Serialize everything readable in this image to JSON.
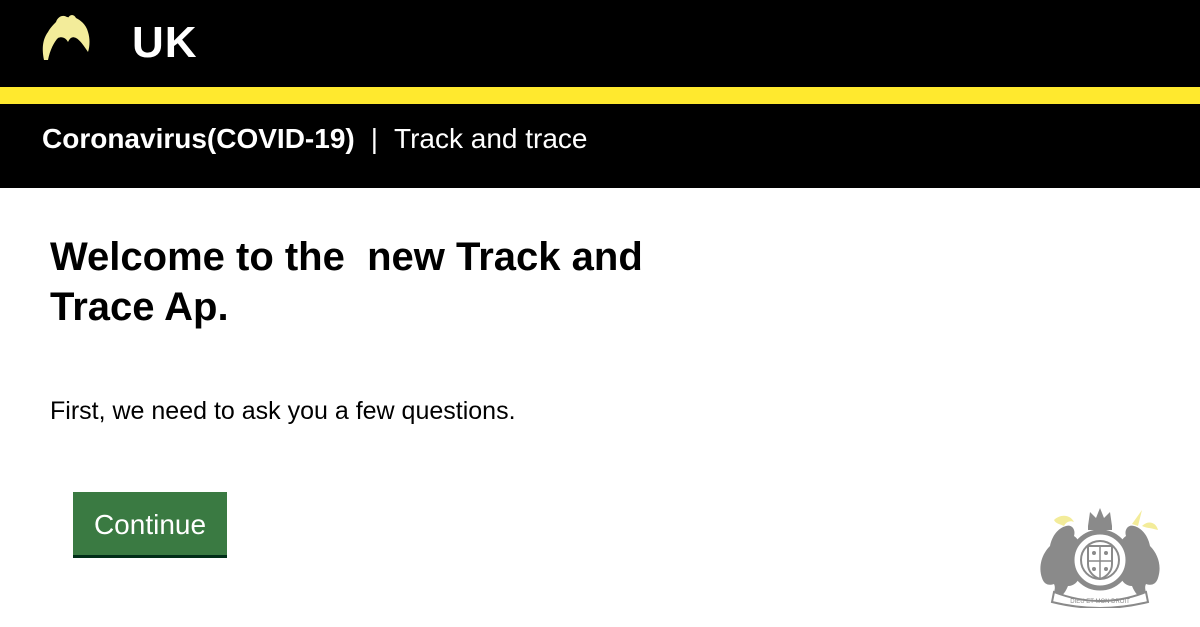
{
  "header": {
    "logo_icon": "crown-icon",
    "brand_title": "UK",
    "stripe_color": "#ffe92e"
  },
  "service_bar": {
    "service_name": "Coronavirus(COVID-19)",
    "separator": "|",
    "subtitle": "Track and trace"
  },
  "main": {
    "title": "Welcome to the  new Track and Trace Ap.",
    "intro": "First, we need to ask you a few questions.",
    "continue_label": "Continue",
    "button_color": "#3a7a42"
  },
  "footer": {
    "emblem_icon": "royal-coat-of-arms-icon",
    "emblem_motto": "DIEU ET MON DROIT"
  }
}
